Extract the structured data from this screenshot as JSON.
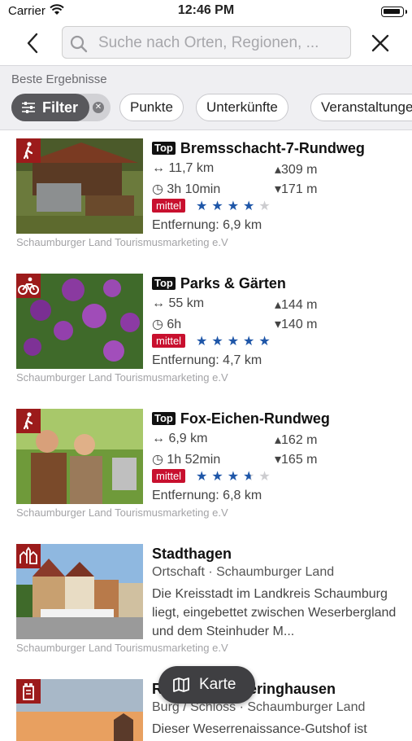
{
  "status": {
    "carrier": "Carrier",
    "time": "12:46 PM"
  },
  "search": {
    "placeholder": "Suche nach Orten, Regionen, ..."
  },
  "filters": {
    "heading": "Beste Ergebnisse",
    "filter_label": "Filter",
    "chips": [
      "Punkte",
      "Unterkünfte",
      "Veranstaltungen"
    ]
  },
  "results": [
    {
      "title": "Bremsschacht-7-Rundweg",
      "top": "Top",
      "icon": "hiking-icon",
      "distance": "11,7 km",
      "duration": "3h 10min",
      "ascent": "309 m",
      "descent": "171 m",
      "difficulty": "mittel",
      "rating": 4,
      "entfernung": "Entfernung: 6,9 km",
      "source": "Schaumburger Land Tourismusmarketing e.V"
    },
    {
      "title": "Parks & Gärten",
      "top": "Top",
      "icon": "cycling-icon",
      "distance": "55 km",
      "duration": "6h",
      "ascent": "144 m",
      "descent": "140 m",
      "difficulty": "mittel",
      "rating": 5,
      "entfernung": "Entfernung: 4,7 km",
      "source": "Schaumburger Land Tourismusmarketing e.V"
    },
    {
      "title": "Fox-Eichen-Rundweg",
      "top": "Top",
      "icon": "hiking-icon",
      "distance": "6,9 km",
      "duration": "1h 52min",
      "ascent": "162 m",
      "descent": "165 m",
      "difficulty": "mittel",
      "rating": 3.5,
      "entfernung": "Entfernung: 6,8 km",
      "source": "Schaumburger Land Tourismusmarketing e.V"
    },
    {
      "title": "Stadthagen",
      "icon": "town-icon",
      "subtitle": "Ortschaft · Schaumburger Land",
      "description": "Die Kreisstadt im Landkreis Schaumburg liegt, eingebettet zwischen Weserbergland und dem Steinhuder M...",
      "source": "Schaumburger Land Tourismusmarketing e.V"
    },
    {
      "title": "Rittergut Remeringhausen",
      "icon": "castle-icon",
      "subtitle": "Burg / Schloss · Schaumburger Land",
      "description": "Dieser Weserrenaissance-Gutshof ist"
    }
  ],
  "map_button": {
    "label": "Karte"
  },
  "colors": {
    "accent_red": "#9c1b1b",
    "difficulty_red": "#c8102e",
    "star_blue": "#1e56a8"
  }
}
